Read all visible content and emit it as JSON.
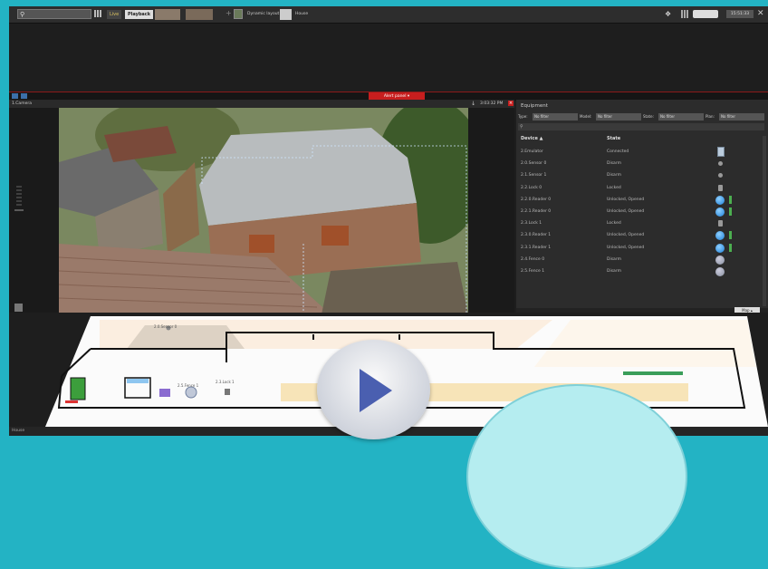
{
  "topbar": {
    "search_placeholder": "",
    "live_label": "Live",
    "playback_label": "Playback",
    "thumb_caption": "Camera layout",
    "dynamic_layout_label": "Dynamic layout",
    "house_label": "House",
    "clock": "15:51:33"
  },
  "panel": {
    "alert_tab": "Alert panel"
  },
  "camera": {
    "title": "1.Camera",
    "timestamp": "3:03:32 PM"
  },
  "equipment": {
    "title": "Equipment",
    "filters": {
      "type_label": "Type:",
      "type_value": "No filter",
      "model_label": "Model:",
      "model_value": "No filter",
      "state_label": "State:",
      "state_value": "No filter",
      "plan_label": "Plan:",
      "plan_value": "No filter"
    },
    "col_device": "Device",
    "col_state": "State",
    "rows": [
      {
        "device": "2.Emulator",
        "state": "Connected",
        "icon": "device-box-icon"
      },
      {
        "device": "2.0.Sensor 0",
        "state": "Disarm",
        "icon": "sensor-dot-icon"
      },
      {
        "device": "2.1.Sensor 1",
        "state": "Disarm",
        "icon": "sensor-dot-icon"
      },
      {
        "device": "2.2.Lock 0",
        "state": "Locked",
        "icon": "lock-icon"
      },
      {
        "device": "2.2.0.Reader 0",
        "state": "Unlocked, Opened",
        "icon": "reader-active-icon"
      },
      {
        "device": "2.2.1.Reader 0",
        "state": "Unlocked, Opened",
        "icon": "reader-active-icon"
      },
      {
        "device": "2.3.Lock 1",
        "state": "Locked",
        "icon": "lock-icon"
      },
      {
        "device": "2.3.0.Reader 1",
        "state": "Unlocked, Opened",
        "icon": "reader-active-icon"
      },
      {
        "device": "2.3.1.Reader 1",
        "state": "Unlocked, Opened",
        "icon": "reader-active-icon"
      },
      {
        "device": "2.4.Fence 0",
        "state": "Disarm",
        "icon": "fence-icon"
      },
      {
        "device": "2.5.Fence 1",
        "state": "Disarm",
        "icon": "fence-icon"
      }
    ],
    "map_tab": "Map"
  },
  "map": {
    "sensor_label": "2.0.Sensor 0",
    "fence_label": "2.5.Fence 1",
    "lock_label": "2.3.Lock 1"
  },
  "status": {
    "text": "House"
  },
  "colors": {
    "accent_red": "#c71e1e",
    "accent_blue": "#1e80d8",
    "background_teal": "#23b3c4"
  }
}
